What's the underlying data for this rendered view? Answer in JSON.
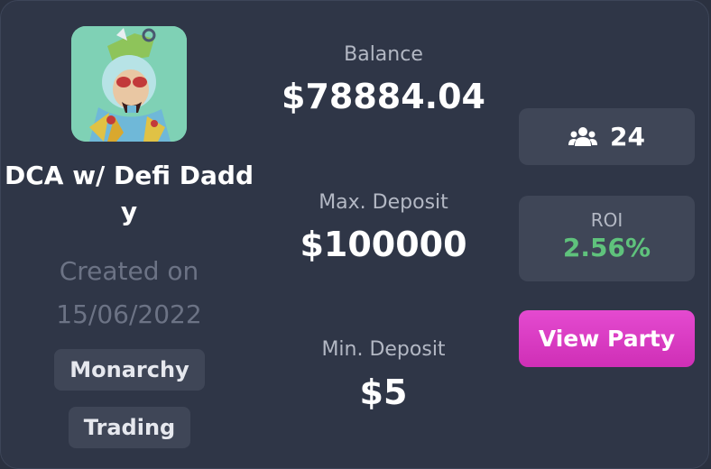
{
  "party": {
    "name": "DCA w/ Defi Daddy",
    "created": "Created on 15/06/2022",
    "avatar_icon": "ape-nft-avatar",
    "tags": [
      "Monarchy",
      "Trading"
    ]
  },
  "stats": {
    "balance_label": "Balance",
    "balance_value": "$78884.04",
    "max_deposit_label": "Max. Deposit",
    "max_deposit_value": "$100000",
    "min_deposit_label": "Min. Deposit",
    "min_deposit_value": "$5"
  },
  "members": {
    "icon": "users-icon",
    "count": "24"
  },
  "roi": {
    "label": "ROI",
    "value": "2.56%"
  },
  "actions": {
    "view_party_label": "View Party"
  },
  "colors": {
    "card_bg": "#2f3647",
    "box_bg": "#3f4657",
    "roi_green": "#5fc27c",
    "button_pink": "#d936c0",
    "muted_text": "#6c7385"
  }
}
